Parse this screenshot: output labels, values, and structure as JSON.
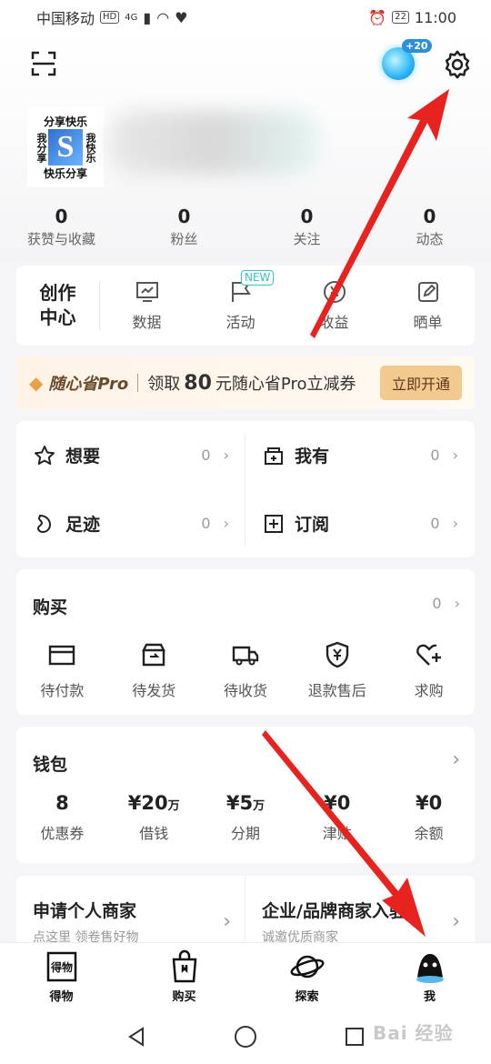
{
  "status": {
    "carrier": "中国移动",
    "hd": "HD",
    "net": "4G",
    "right_badge": "22",
    "time": "11:00"
  },
  "header": {
    "gem_badge": "+20"
  },
  "avatar": {
    "top": "分享快乐",
    "left": "我分享",
    "letter": "S",
    "right": "我快乐",
    "bottom": "快乐分享"
  },
  "stats": [
    {
      "num": "0",
      "label": "获赞与收藏"
    },
    {
      "num": "0",
      "label": "粉丝"
    },
    {
      "num": "0",
      "label": "关注"
    },
    {
      "num": "0",
      "label": "动态"
    }
  ],
  "creator": {
    "title": "创作中心",
    "items": [
      {
        "label": "数据",
        "icon": "chart-icon"
      },
      {
        "label": "活动",
        "icon": "flag-icon",
        "badge": "NEW"
      },
      {
        "label": "收益",
        "icon": "yen-icon"
      },
      {
        "label": "晒单",
        "icon": "edit-icon"
      }
    ]
  },
  "promo": {
    "brand": "随心省Pro",
    "text_pre": "领取",
    "amount": "80",
    "text_post": "元随心省Pro立减券",
    "button": "立即开通"
  },
  "wants": [
    {
      "label": "想要",
      "count": "0",
      "icon": "star-icon"
    },
    {
      "label": "我有",
      "count": "0",
      "icon": "owned-icon"
    },
    {
      "label": "足迹",
      "count": "0",
      "icon": "footprint-icon"
    },
    {
      "label": "订阅",
      "count": "0",
      "icon": "subscribe-icon"
    }
  ],
  "buy": {
    "title": "购买",
    "count": "0",
    "items": [
      {
        "label": "待付款",
        "icon": "card-icon"
      },
      {
        "label": "待发货",
        "icon": "box-icon"
      },
      {
        "label": "待收货",
        "icon": "truck-icon"
      },
      {
        "label": "退款售后",
        "icon": "shield-yen-icon"
      },
      {
        "label": "求购",
        "icon": "heart-plus-icon"
      }
    ]
  },
  "wallet": {
    "title": "钱包",
    "items": [
      {
        "value": "8",
        "unit": "",
        "label": "优惠券"
      },
      {
        "value": "¥20",
        "unit": "万",
        "label": "借钱"
      },
      {
        "value": "¥5",
        "unit": "万",
        "label": "分期"
      },
      {
        "value": "¥0",
        "unit": "",
        "label": "津贴"
      },
      {
        "value": "¥0",
        "unit": "",
        "label": "余额"
      }
    ]
  },
  "merchant": [
    {
      "title": "申请个人商家",
      "sub": "点这里 领卷售好物"
    },
    {
      "title": "企业/品牌商家入驻",
      "sub": "诚邀优质商家"
    }
  ],
  "tabs": [
    {
      "label": "得物",
      "icon": "dewu-logo-icon"
    },
    {
      "label": "购买",
      "icon": "bag-icon"
    },
    {
      "label": "探索",
      "icon": "planet-icon"
    },
    {
      "label": "我",
      "icon": "avatar-ghost-icon"
    }
  ],
  "watermark": "Bai 经验",
  "colors": {
    "accent": "#38c3c6",
    "arrow": "#e8231f",
    "promo_btn": "#f2c98e"
  }
}
